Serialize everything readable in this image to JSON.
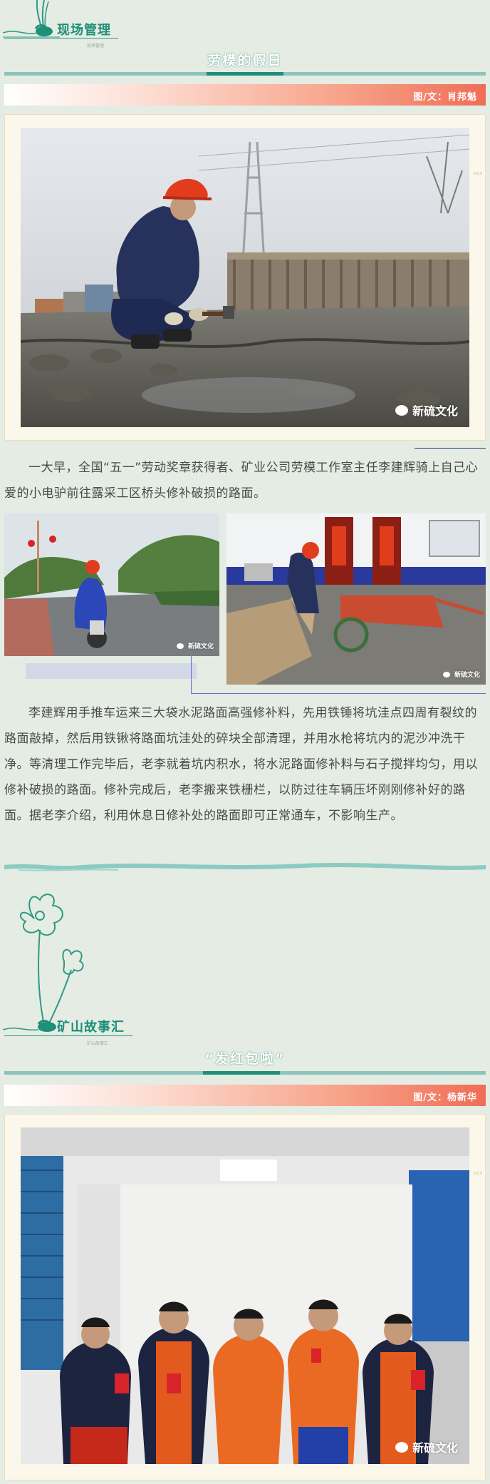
{
  "section1": {
    "header": "现场管理",
    "sub": "现场管理",
    "article_title": "劳模的假日",
    "byline": "图/文：肖邦魁"
  },
  "section1_text": {
    "p1": "一大早，全国“五一”劳动奖章获得者、矿业公司劳模工作室主任李建辉骑上自己心爱的小电驴前往露采工区桥头修补破损的路面。",
    "p2": "李建辉用手推车运来三大袋水泥路面高强修补料，先用铁锤将坑洼点四周有裂纹的路面敲掉，然后用铁锹将路面坑洼处的碎块全部清理，并用水枪将坑内的泥沙冲洗干净。等清理工作完毕后，老李就着坑内积水，将水泥路面修补料与石子搅拌均匀，用以修补破损的路面。修补完成后，老李搬来铁栅栏，以防过往车辆压坏刚刚修补好的路面。据老李介绍，利用休息日修补处的路面即可正常通车，不影响生产。"
  },
  "section2": {
    "header": "矿山故事汇",
    "sub": "矿山故事汇",
    "article_title": "“发红包啦”",
    "byline": "图/文：杨新华"
  },
  "watermark": {
    "text": "新硫文化"
  },
  "frame_label": "2019"
}
